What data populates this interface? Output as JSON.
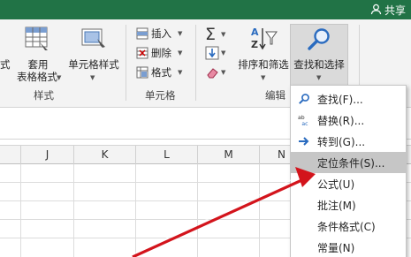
{
  "titlebar": {
    "share_label": "共享"
  },
  "ribbon": {
    "styles_group": {
      "partial_label": "式",
      "table_format_line1": "套用",
      "table_format_line2": "表格格式",
      "cell_style_label": "单元格样式",
      "group_label": "样式"
    },
    "cells_group": {
      "insert_label": "插入",
      "delete_label": "删除",
      "format_label": "格式",
      "group_label": "单元格"
    },
    "editing_group": {
      "sort_filter_label": "排序和筛选",
      "find_select_label": "查找和选择",
      "group_label": "编辑"
    }
  },
  "columns": [
    "J",
    "K",
    "L",
    "M",
    "N"
  ],
  "menu": {
    "items": [
      {
        "label": "查找(F)...",
        "icon": "magnifier-icon"
      },
      {
        "label": "替换(R)...",
        "icon": "replace-abc-icon"
      },
      {
        "label": "转到(G)...",
        "icon": "arrow-right-icon"
      },
      {
        "label": "定位条件(S)...",
        "icon": "none",
        "highlighted": true
      },
      {
        "label": "公式(U)",
        "icon": "none"
      },
      {
        "label": "批注(M)",
        "icon": "none"
      },
      {
        "label": "条件格式(C)",
        "icon": "none"
      },
      {
        "label": "常量(N)",
        "icon": "none"
      }
    ]
  },
  "colors": {
    "titlebar": "#217346",
    "ribbon_bg": "#f3f3f3",
    "arrow": "#d3141c",
    "menu_highlight": "#c6c6c6"
  }
}
